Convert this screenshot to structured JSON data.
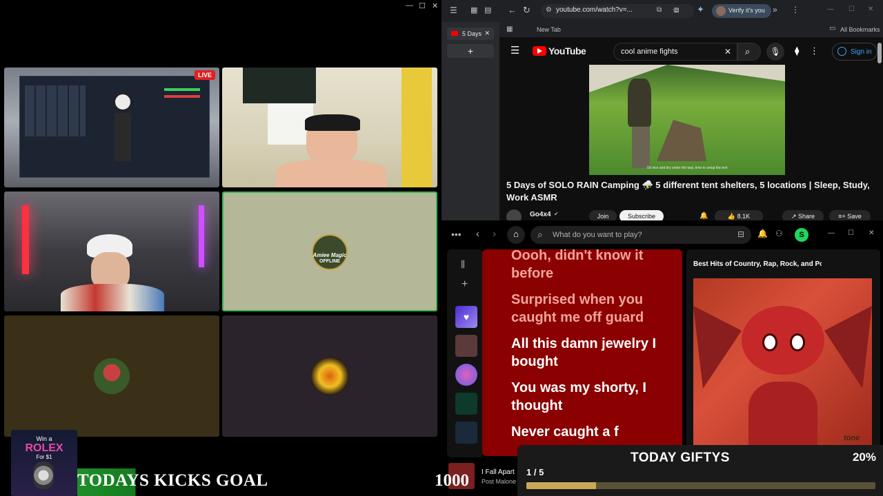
{
  "stream": {
    "live_badge": "LIVE",
    "offline_logo": "Amiee Magic",
    "offline_label": "OFFLINE"
  },
  "browser": {
    "url": "youtube.com/watch?v=...",
    "verify_label": "Verify it's you",
    "tab_label": "5 Days",
    "new_tab_bookmark": "New Tab",
    "all_bookmarks": "All Bookmarks",
    "yt_logo": "YouTube",
    "search_query": "cool anime fights",
    "signin_label": "Sign in",
    "video_caption": "Ok nice and dry under the tarp, time to setup the tent",
    "video_title": "5 Days of SOLO RAIN Camping ⛈️ 5 different tent shelters, 5 locations | Sleep, Study, Work ASMR",
    "channel_name": "Go4x4",
    "join_label": "Join",
    "subscribe_label": "Subscribe",
    "likes": "8.1K",
    "share_label": "Share",
    "save_label": "Save"
  },
  "spotify": {
    "search_placeholder": "What do you want to play?",
    "avatar_initial": "S",
    "lyrics": [
      {
        "text": "Oooh, didn't know it before",
        "state": "past"
      },
      {
        "text": "Surprised when you caught me off guard",
        "state": "past"
      },
      {
        "text": "All this damn jewelry I bought",
        "state": "current"
      },
      {
        "text": "You was my shorty, I thought",
        "state": "next"
      },
      {
        "text": "Never caught a f",
        "state": "next"
      }
    ],
    "now_playing_panel_title": "Best Hits of Country, Rap, Rock, and Po",
    "cover_text": "tone",
    "track_title": "I Fall Apart",
    "track_artist": "Post Malone"
  },
  "overlays": {
    "rolex_line1": "Win a",
    "rolex_line2": "ROLEX",
    "rolex_line3": "For $1",
    "goal_label": "TODAYS KICKS GOAL",
    "goal_target": "1000",
    "gifty_title": "TODAY GIFTYS",
    "gifty_percent": "20%",
    "gifty_count": "1 / 5",
    "gifty_progress": 0.2
  },
  "colors": {
    "live_red": "#e02020",
    "offline_border": "#3cb34f",
    "spotify_green": "#1ed760",
    "lyrics_bg": "#8b0000",
    "youtube_red": "#ff0000",
    "gifty_fill": "#c9a959"
  }
}
